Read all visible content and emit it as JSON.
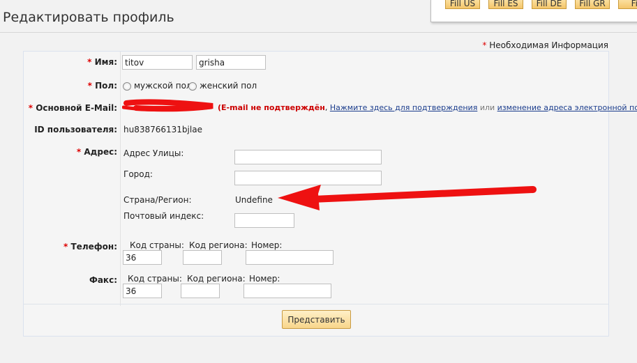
{
  "page": {
    "title": "Редактировать профиль"
  },
  "fill_buttons": [
    "Fill US",
    "Fill ES",
    "Fill DE",
    "Fill GR",
    "Fil"
  ],
  "required_info": "Необходимая Информация",
  "required_mark": "*",
  "form": {
    "name": {
      "label": "Имя:",
      "first": "titov",
      "last": "grisha"
    },
    "gender": {
      "label": "Пол:",
      "male": "мужской пол",
      "female": "женский пол"
    },
    "email": {
      "label": "Основной E-Mail:",
      "paren_open": "(",
      "not_confirmed": "E-mail не подтверждён",
      "comma": ",",
      "confirm_link": "Нажмите здесь для подтверждения",
      "or": "или",
      "change_link": "изменение адреса электронной почты",
      "paren_close": ")"
    },
    "user_id": {
      "label": "ID пользователя:",
      "value": "hu838766131bjlae"
    },
    "address": {
      "label": "Адрес:",
      "street_label": "Адрес Улицы:",
      "street_value": "",
      "city_label": "Город:",
      "city_value": "",
      "country_label": "Страна/Регион:",
      "country_value": "Undefine",
      "zip_label": "Почтовый индекс:",
      "zip_value": ""
    },
    "phone": {
      "label": "Телефон:",
      "country_code_label": "Код страны:",
      "region_code_label": "Код региона:",
      "number_label": "Номер:",
      "country_code": "36",
      "region_code": "",
      "number": ""
    },
    "fax": {
      "label": "Факс:",
      "country_code_label": "Код страны:",
      "region_code_label": "Код региона:",
      "number_label": "Номер:",
      "country_code": "36",
      "region_code": "",
      "number": ""
    },
    "submit_label": "Представить"
  },
  "colors": {
    "required": "#dd0000",
    "error": "#cc0000",
    "link": "#1a3c8c",
    "annotation": "#ee1111"
  }
}
